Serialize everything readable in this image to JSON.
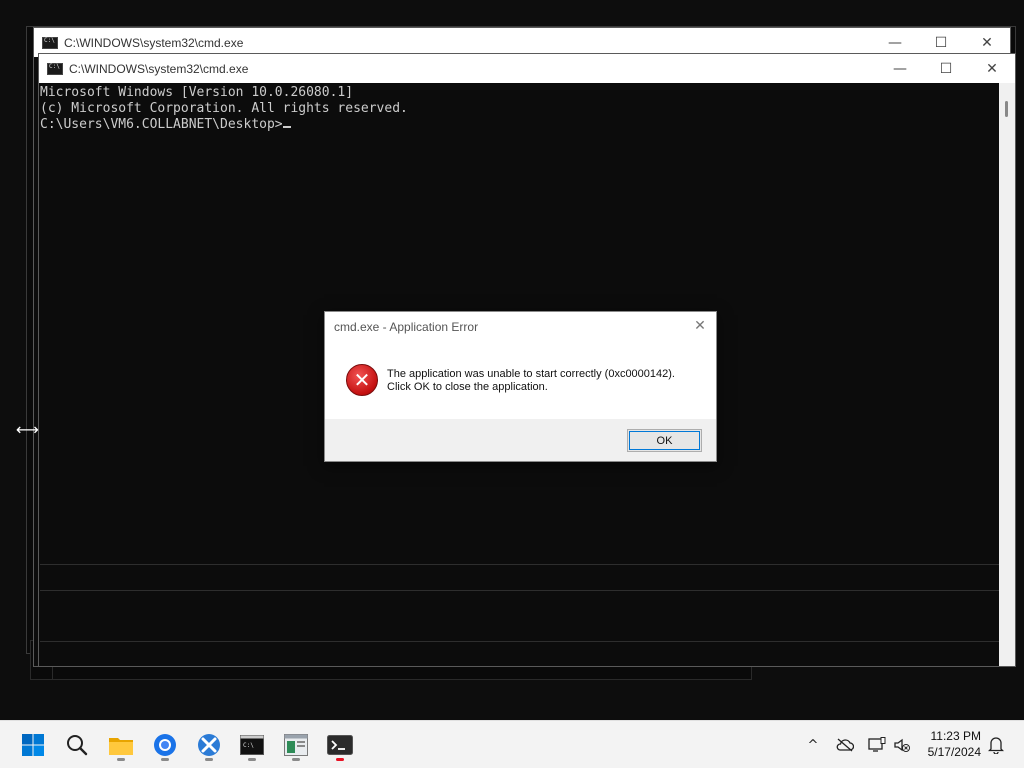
{
  "back_window": {
    "title": "C:\\WINDOWS\\system32\\cmd.exe",
    "minimize": "—",
    "maximize": "☐",
    "close": "✕"
  },
  "front_window": {
    "title": "C:\\WINDOWS\\system32\\cmd.exe",
    "minimize": "—",
    "maximize": "☐",
    "close": "✕",
    "console_lines": [
      "Microsoft Windows [Version 10.0.26080.1]",
      "(c) Microsoft Corporation. All rights reserved.",
      "",
      "C:\\Users\\VM6.COLLABNET\\Desktop>"
    ]
  },
  "dialog": {
    "title": "cmd.exe - Application Error",
    "close": "✕",
    "icon": "error-icon",
    "icon_glyph": "✕",
    "message_line1": "The application was unable to start correctly (0xc0000142).",
    "message_line2": "Click OK to close the application.",
    "ok_label": "OK"
  },
  "cursor_glyph": "⟷",
  "taskbar": {
    "items": [
      {
        "name": "start-icon"
      },
      {
        "name": "search-icon"
      },
      {
        "name": "file-explorer-icon"
      },
      {
        "name": "browser-icon"
      },
      {
        "name": "app-icon"
      },
      {
        "name": "cmd-icon"
      },
      {
        "name": "notepad-icon"
      },
      {
        "name": "terminal-icon"
      }
    ],
    "tray": {
      "chevron": "^",
      "time": "11:23 PM",
      "date": "5/17/2024"
    }
  },
  "colors": {
    "console_bg": "#0c0c0c",
    "console_text": "#cccccc",
    "error_red": "#c41010",
    "accent": "#0078d7",
    "taskbar_bg": "#f3f3f3"
  }
}
